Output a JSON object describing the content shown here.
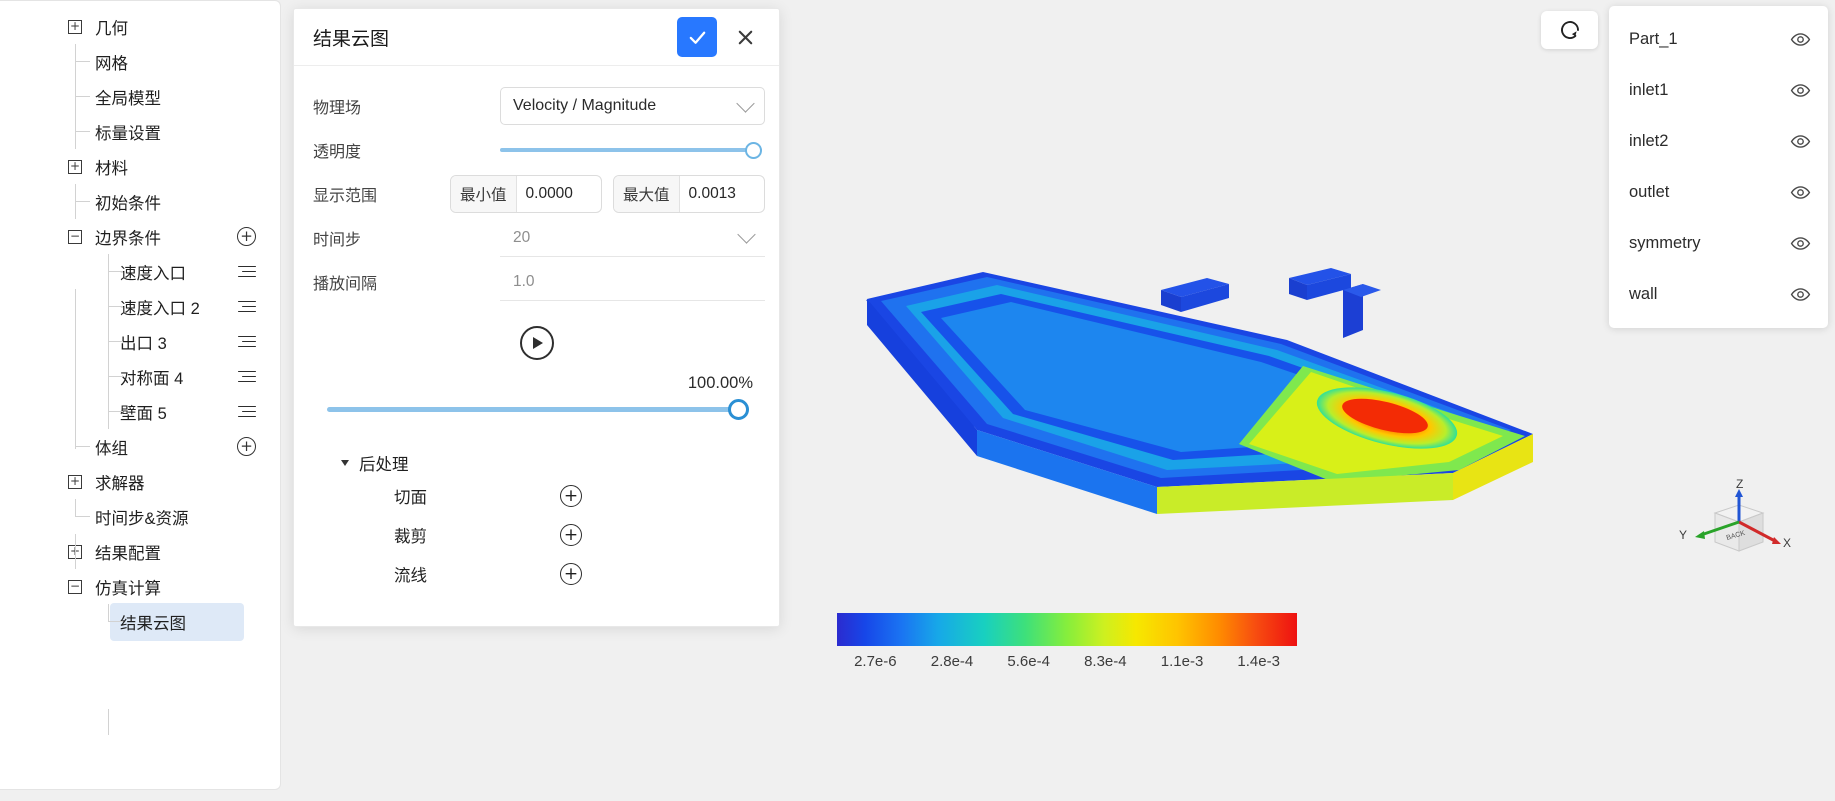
{
  "sidebar": {
    "items": [
      {
        "label": "几何",
        "level": 0,
        "type": "expand",
        "state": "+",
        "action": "none"
      },
      {
        "label": "网格",
        "level": 0,
        "type": "leaf",
        "action": "none"
      },
      {
        "label": "全局模型",
        "level": 0,
        "type": "leaf",
        "action": "none"
      },
      {
        "label": "标量设置",
        "level": 0,
        "type": "leaf",
        "action": "none"
      },
      {
        "label": "材料",
        "level": 0,
        "type": "expand",
        "state": "+",
        "action": "none"
      },
      {
        "label": "初始条件",
        "level": 0,
        "type": "leaf",
        "action": "none"
      },
      {
        "label": "边界条件",
        "level": 0,
        "type": "expand",
        "state": "−",
        "action": "plus"
      },
      {
        "label": "速度入口",
        "level": 1,
        "type": "leaf",
        "action": "menu"
      },
      {
        "label": "速度入口 2",
        "level": 1,
        "type": "leaf",
        "action": "menu"
      },
      {
        "label": "出口 3",
        "level": 1,
        "type": "leaf",
        "action": "menu"
      },
      {
        "label": "对称面 4",
        "level": 1,
        "type": "leaf",
        "action": "menu"
      },
      {
        "label": "壁面 5",
        "level": 1,
        "type": "leaf",
        "action": "menu"
      },
      {
        "label": "体组",
        "level": 0,
        "type": "leaf",
        "action": "plus"
      },
      {
        "label": "求解器",
        "level": 0,
        "type": "expand",
        "state": "+",
        "action": "none"
      },
      {
        "label": "时间步&资源",
        "level": 0,
        "type": "leaf",
        "action": "none"
      },
      {
        "label": "结果配置",
        "level": 0,
        "type": "expand",
        "state": "+",
        "action": "none"
      },
      {
        "label": "仿真计算",
        "level": 0,
        "type": "expand",
        "state": "−",
        "action": "none"
      },
      {
        "label": "结果云图",
        "level": 1,
        "type": "leaf",
        "action": "none",
        "selected": true
      }
    ]
  },
  "dialog": {
    "title": "结果云图",
    "confirm_label": "确认",
    "cancel_label": "取消",
    "fields": {
      "physics_label": "物理场",
      "physics_value": "Velocity / Magnitude",
      "opacity_label": "透明度",
      "opacity_percent": 100,
      "range_label": "显示范围",
      "min_tag": "最小值",
      "min_value": "0.0000",
      "max_tag": "最大值",
      "max_value": "0.0013",
      "timestep_label": "时间步",
      "timestep_value": "20",
      "interval_label": "播放间隔",
      "interval_value": "1.0"
    },
    "playback": {
      "play_label": "播放",
      "progress_text": "100.00%",
      "progress_percent": 100
    },
    "post": {
      "header": "后处理",
      "items": [
        {
          "label": "切面",
          "add": "+"
        },
        {
          "label": "裁剪",
          "add": "+"
        },
        {
          "label": "流线",
          "add": "+"
        }
      ]
    }
  },
  "viewport": {
    "reset_label": "重置视角",
    "parts": [
      {
        "name": "Part_1",
        "visible": true
      },
      {
        "name": "inlet1",
        "visible": true
      },
      {
        "name": "inlet2",
        "visible": true
      },
      {
        "name": "outlet",
        "visible": true
      },
      {
        "name": "symmetry",
        "visible": true
      },
      {
        "name": "wall",
        "visible": true
      }
    ],
    "triad": {
      "x": "X",
      "y": "Y",
      "z": "Z",
      "face": "BACK"
    }
  },
  "chart_data": {
    "type": "heatmap",
    "title": "Velocity / Magnitude",
    "colorbar_ticks": [
      "2.7e-6",
      "2.8e-4",
      "5.6e-4",
      "8.3e-4",
      "1.1e-3",
      "1.4e-3"
    ],
    "vmin": 2.7e-06,
    "vmax": 0.0014,
    "colormap": "jet",
    "orientation": "horizontal",
    "legend": "bottom"
  }
}
